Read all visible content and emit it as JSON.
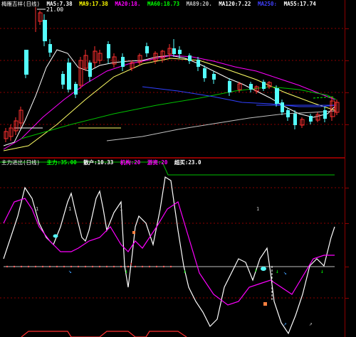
{
  "upper": {
    "title": "梅雁吉祥(日线)",
    "indicators": [
      {
        "label": "MA5:",
        "value": "7.38",
        "color": "#ffffff"
      },
      {
        "label": "MA9:",
        "value": "17.38",
        "color": "#ffff00"
      },
      {
        "label": "MA20:",
        "value": "18.",
        "color": "#ff00ff"
      },
      {
        "label": "MA60:",
        "value": "18.73",
        "color": "#00ff00"
      },
      {
        "label": "MA89:",
        "value": "20.",
        "color": "#c0c0c0"
      },
      {
        "label": "MA120:",
        "value": "7.22",
        "color": "#ffffff"
      },
      {
        "label": "MA250:",
        "value": "",
        "color": "#4040ff"
      },
      {
        "label": "MA55:",
        "value": "17.74",
        "color": "#ffffff"
      }
    ],
    "high_label": "21.00"
  },
  "lower": {
    "title": "主力进出(日线)",
    "indicators": [
      {
        "label": "主力:",
        "value": "35.00",
        "color": "#00ff00"
      },
      {
        "label": "散户:",
        "value": "10.33",
        "color": "#ffffff"
      },
      {
        "label": "机构:",
        "value": "20",
        "color": "#ff00ff"
      },
      {
        "label": "游资:",
        "value": "20",
        "color": "#ff00ff"
      },
      {
        "label": "超买:",
        "value": "23.0",
        "color": "#ffffff"
      }
    ]
  },
  "colors": {
    "background": "#000000",
    "up_candle": "#ff3030",
    "down_candle": "#54ffff",
    "grid": "#8b0000"
  }
}
